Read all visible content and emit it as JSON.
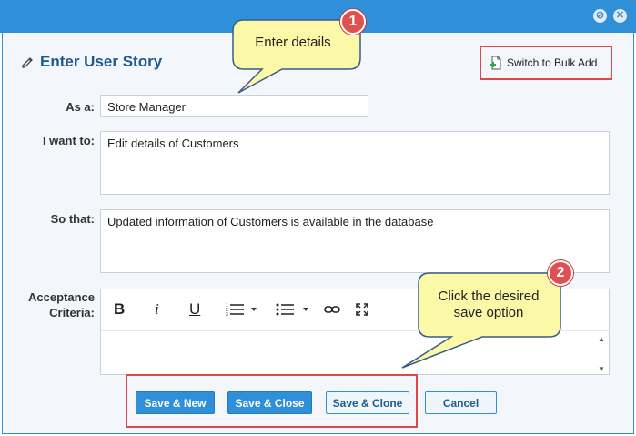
{
  "window": {
    "minimize_icon": "minimize-icon",
    "close_icon": "close-icon"
  },
  "header": {
    "title": "Enter User Story",
    "title_icon": "pencil-icon"
  },
  "bulk_add": {
    "label": "Switch to Bulk Add",
    "icon": "add-document-icon"
  },
  "form": {
    "as_a": {
      "label": "As a:",
      "value": "Store Manager"
    },
    "i_want_to": {
      "label": "I want to:",
      "value": "Edit details of Customers"
    },
    "so_that": {
      "label": "So that:",
      "value": "Updated information of Customers is available in the database"
    },
    "acceptance": {
      "label_line1": "Acceptance",
      "label_line2": "Criteria:",
      "value": ""
    }
  },
  "editor_toolbar": {
    "bold": "B",
    "italic": "i",
    "underline": "U",
    "tools": [
      "bold-icon",
      "italic-icon",
      "underline-icon",
      "ordered-list-icon",
      "bullet-list-icon",
      "link-icon",
      "fullscreen-icon"
    ]
  },
  "buttons": {
    "save_new": "Save & New",
    "save_close": "Save & Close",
    "save_clone": "Save & Clone",
    "cancel": "Cancel"
  },
  "callouts": {
    "one": {
      "number": "1",
      "text": "Enter details"
    },
    "two": {
      "number": "2",
      "line1": "Click the desired",
      "line2": "save option"
    }
  },
  "colors": {
    "accent": "#2f8fd8",
    "highlight": "#e04848",
    "callout": "#fbf8a8"
  }
}
